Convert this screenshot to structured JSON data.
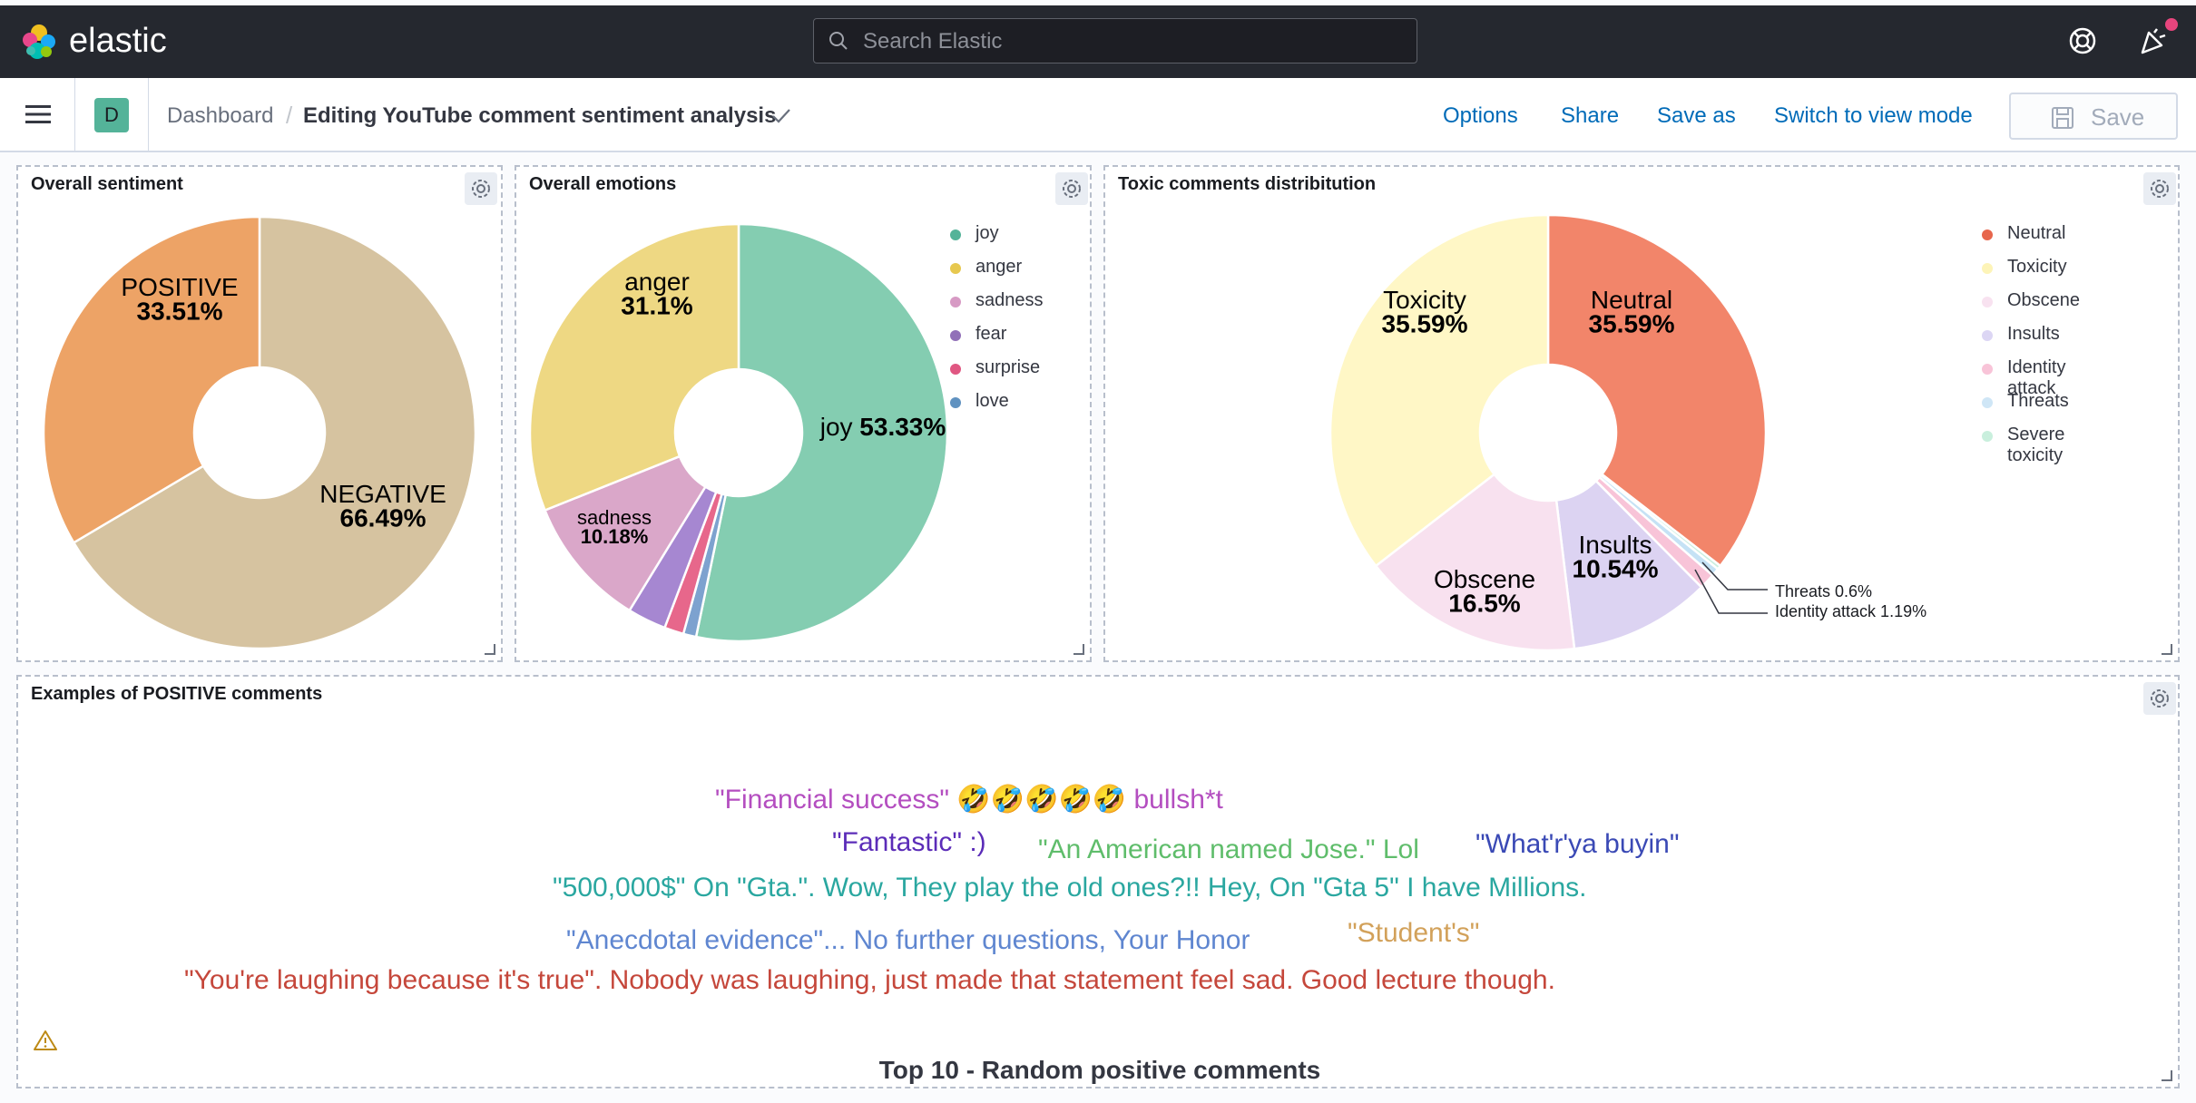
{
  "app": {
    "brand": "elastic",
    "search_placeholder": "Search Elastic"
  },
  "breadcrumb": {
    "root": "Dashboard",
    "current": "Editing YouTube comment sentiment analysis"
  },
  "actions": {
    "options": "Options",
    "share": "Share",
    "save_as": "Save as",
    "switch_view": "Switch to view mode",
    "save": "Save"
  },
  "avatar_letter": "D",
  "panels": {
    "sentiment": {
      "title": "Overall sentiment",
      "slices": [
        {
          "label": "NEGATIVE",
          "value": "66.49%",
          "pct": 66.49,
          "color": "#d6c3a0"
        },
        {
          "label": "POSITIVE",
          "value": "33.51%",
          "pct": 33.51,
          "color": "#eda366"
        }
      ]
    },
    "emotions": {
      "title": "Overall emotions",
      "slices": [
        {
          "label": "joy",
          "value": "53.33%",
          "pct": 53.33,
          "color": "#84cdb1"
        },
        {
          "label": "love",
          "value": "",
          "pct": 1.0,
          "color": "#7da2cf"
        },
        {
          "label": "surprise",
          "value": "",
          "pct": 1.5,
          "color": "#e7678b"
        },
        {
          "label": "fear",
          "value": "",
          "pct": 3.0,
          "color": "#a687d1"
        },
        {
          "label": "sadness",
          "value": "10.18%",
          "pct": 10.18,
          "color": "#daa7c9"
        },
        {
          "label": "anger",
          "value": "31.1%",
          "pct": 31.1,
          "color": "#eed883"
        }
      ],
      "legend": [
        {
          "label": "joy",
          "color": "#54b399"
        },
        {
          "label": "anger",
          "color": "#e7c84f"
        },
        {
          "label": "sadness",
          "color": "#d79ac4"
        },
        {
          "label": "fear",
          "color": "#9170b8"
        },
        {
          "label": "surprise",
          "color": "#e05782"
        },
        {
          "label": "love",
          "color": "#6092c0"
        }
      ]
    },
    "toxic": {
      "title": "Toxic comments distribitution",
      "slices": [
        {
          "label": "Neutral",
          "value": "35.59%",
          "pct": 35.59,
          "color": "#f2856a"
        },
        {
          "label": "Severe toxicity",
          "value": "",
          "pct": 0.3,
          "color": "#cbeee0"
        },
        {
          "label": "Threats",
          "value": "0.6%",
          "pct": 0.6,
          "color": "#c5e2f5"
        },
        {
          "label": "Identity attack",
          "value": "1.19%",
          "pct": 1.19,
          "color": "#f8c4d8"
        },
        {
          "label": "Insults",
          "value": "10.54%",
          "pct": 10.54,
          "color": "#dcd3f2"
        },
        {
          "label": "Obscene",
          "value": "16.5%",
          "pct": 16.5,
          "color": "#f8e1ef"
        },
        {
          "label": "Toxicity",
          "value": "35.59%",
          "pct": 35.59,
          "color": "#fff7c6"
        }
      ],
      "legend": [
        {
          "label": "Neutral",
          "color": "#e7664c"
        },
        {
          "label": "Toxicity",
          "color": "#fdf4b8"
        },
        {
          "label": "Obscene",
          "color": "#f8e2f0"
        },
        {
          "label": "Insults",
          "color": "#dcd6f4"
        },
        {
          "label": "Identity attack",
          "color": "#f8c4d8"
        },
        {
          "label": "Threats",
          "color": "#cfe6f6"
        },
        {
          "label": "Severe toxicity",
          "color": "#c9efdd"
        }
      ],
      "callouts": {
        "threats": "Threats  0.6%",
        "identity": "Identity attack  1.19%"
      }
    },
    "examples": {
      "title": "Examples of POSITIVE comments",
      "words": [
        {
          "text": "\"Financial success\" 🤣🤣🤣🤣🤣 bullsh*t",
          "color": "#b44ec0"
        },
        {
          "text": "\"Fantastic\" :)",
          "color": "#5b2cb8"
        },
        {
          "text": "\"An American named Jose.\" Lol",
          "color": "#5fbd6b"
        },
        {
          "text": "\"What'r'ya buyin\"",
          "color": "#3a49b5"
        },
        {
          "text": "\"500,000$\" On \"Gta.\". Wow, They play the old ones?!! Hey, On \"Gta 5\" I have Millions.",
          "color": "#2aa7a0"
        },
        {
          "text": "\"Anecdotal evidence\"... No further questions, Your Honor",
          "color": "#5f86d0"
        },
        {
          "text": "\"Student's\"",
          "color": "#d2a15a"
        },
        {
          "text": "\"You're laughing because it's true\". Nobody was laughing, just made that statement feel sad. Good lecture though.",
          "color": "#c5473b"
        }
      ],
      "footer": "Top 10 - Random positive comments"
    }
  }
}
